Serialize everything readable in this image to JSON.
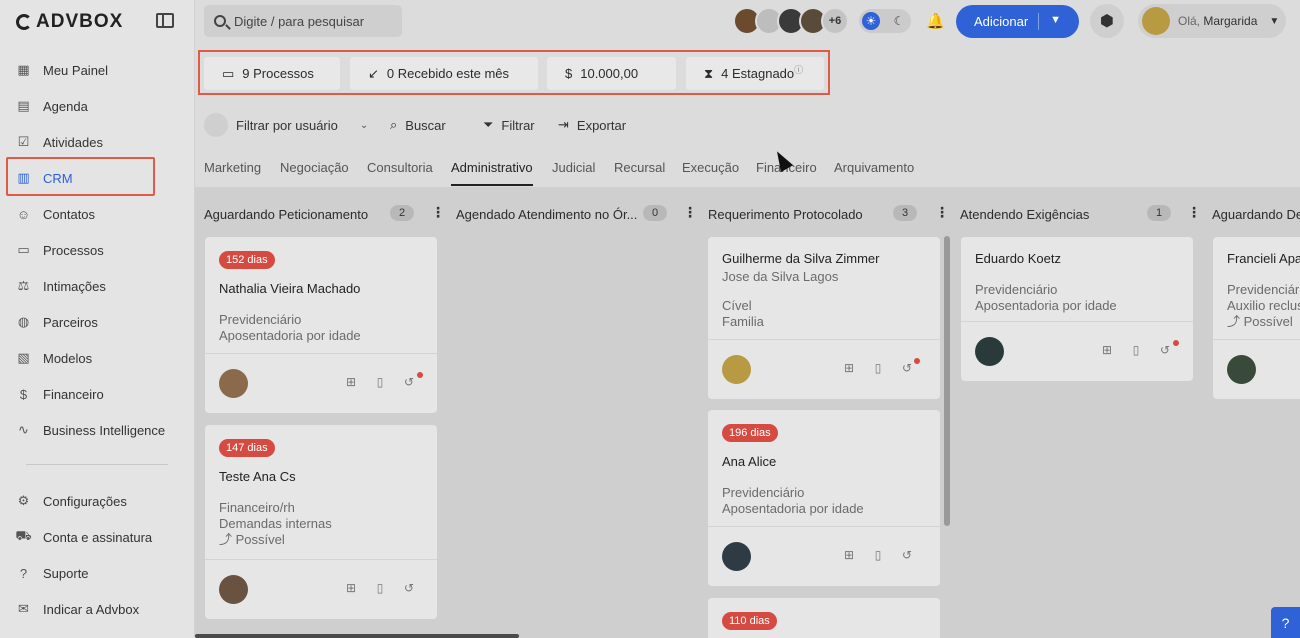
{
  "app": {
    "brand": "ADVBOX"
  },
  "sidebar": {
    "items": [
      {
        "label": "Meu Painel",
        "icon": "▦"
      },
      {
        "label": "Agenda",
        "icon": "▤"
      },
      {
        "label": "Atividades",
        "icon": "☑"
      },
      {
        "label": "CRM",
        "icon": "▥",
        "active": true
      },
      {
        "label": "Contatos",
        "icon": "☺"
      },
      {
        "label": "Processos",
        "icon": "▭"
      },
      {
        "label": "Intimações",
        "icon": "⚖"
      },
      {
        "label": "Parceiros",
        "icon": "◍"
      },
      {
        "label": "Modelos",
        "icon": "▧"
      },
      {
        "label": "Financeiro",
        "icon": "$"
      },
      {
        "label": "Business Intelligence",
        "icon": "∿"
      }
    ],
    "bottom_items": [
      {
        "label": "Configurações",
        "icon": "⚙"
      },
      {
        "label": "Conta e assinatura",
        "icon": "⛟"
      },
      {
        "label": "Suporte",
        "icon": "?"
      },
      {
        "label": "Indicar a Advbox",
        "icon": "✉"
      }
    ]
  },
  "topbar": {
    "search_placeholder": "Digite / para pesquisar",
    "avatars_more": "+6",
    "add_label": "Adicionar",
    "greeting": "Olá, ",
    "user_name": "Margarida"
  },
  "summary": {
    "processos": "9 Processos",
    "recebido": "0 Recebido este mês",
    "valor_symbol": "$",
    "valor": "10.000,00",
    "estagnado": "4 Estagnado"
  },
  "toolbar": {
    "filter_user": "Filtrar por usuário",
    "buscar": "Buscar",
    "filtrar": "Filtrar",
    "exportar": "Exportar"
  },
  "tabs": [
    "Marketing",
    "Negociação",
    "Consultoria",
    "Administrativo",
    "Judicial",
    "Recursal",
    "Execução",
    "Financeiro",
    "Arquivamento"
  ],
  "active_tab": "Administrativo",
  "columns": [
    {
      "title": "Aguardando Peticionamento",
      "count": "2"
    },
    {
      "title": "Agendado Atendimento no Ór...",
      "count": "0"
    },
    {
      "title": "Requerimento Protocolado",
      "count": "3"
    },
    {
      "title": "Atendendo Exigências",
      "count": "1"
    },
    {
      "title": "Aguardando De",
      "count": ""
    }
  ],
  "cards": {
    "c1": {
      "badge": "152 dias",
      "name": "Nathalia Vieira Machado",
      "l1": "Previdenciário",
      "l2": "Aposentadoria por idade"
    },
    "c2": {
      "badge": "147 dias",
      "name": "Teste Ana Cs",
      "l1": "Financeiro/rh",
      "l2": "Demandas internas",
      "l3": "Possível"
    },
    "c3": {
      "name": "Guilherme da Silva Zimmer",
      "sub": "Jose da Silva Lagos",
      "l1": "Cível",
      "l2": "Familia"
    },
    "c4": {
      "badge": "196 dias",
      "name": "Ana Alice",
      "l1": "Previdenciário",
      "l2": "Aposentadoria por idade"
    },
    "c5": {
      "badge": "110 dias"
    },
    "c6": {
      "name": "Eduardo Koetz",
      "l1": "Previdenciário",
      "l2": "Aposentadoria por idade"
    },
    "c7": {
      "name": "Francieli Apa",
      "l1": "Previdenciário",
      "l2": "Auxilio reclus",
      "l3": "Possível"
    }
  },
  "colors": {
    "accent": "#2f62d6",
    "danger": "#d54b42",
    "highlight": "#e05a4a"
  }
}
